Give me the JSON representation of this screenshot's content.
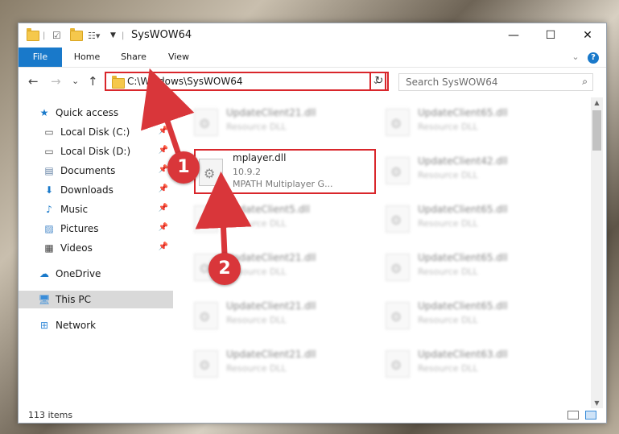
{
  "window": {
    "title": "SysWOW64",
    "minimize": "—",
    "maximize": "☐",
    "close": "✕"
  },
  "ribbon": {
    "tabs": [
      "File",
      "Home",
      "Share",
      "View"
    ],
    "collapse": "⌄",
    "help": "?"
  },
  "nav": {
    "back": "←",
    "forward": "→",
    "recent": "⌄",
    "up": "↑",
    "address": "C:\\Windows\\SysWOW64",
    "refresh": "↻",
    "search_placeholder": "Search SysWOW64"
  },
  "sidebar": {
    "items": [
      {
        "label": "Quick access",
        "icon": "star-icon",
        "pinned": false
      },
      {
        "label": "Local Disk (C:)",
        "icon": "drive-icon",
        "pinned": true
      },
      {
        "label": "Local Disk (D:)",
        "icon": "drive-icon",
        "pinned": true
      },
      {
        "label": "Documents",
        "icon": "documents-icon",
        "pinned": true
      },
      {
        "label": "Downloads",
        "icon": "downloads-icon",
        "pinned": true
      },
      {
        "label": "Music",
        "icon": "music-icon",
        "pinned": true
      },
      {
        "label": "Pictures",
        "icon": "pictures-icon",
        "pinned": true
      },
      {
        "label": "Videos",
        "icon": "videos-icon",
        "pinned": true
      },
      {
        "label": "OneDrive",
        "icon": "cloud-icon",
        "pinned": false
      },
      {
        "label": "This PC",
        "icon": "computer-icon",
        "pinned": false
      },
      {
        "label": "Network",
        "icon": "network-icon",
        "pinned": false
      }
    ]
  },
  "files": {
    "highlighted": {
      "name": "mplayer.dll",
      "version": "10.9.2",
      "description": "MPATH Multiplayer G..."
    },
    "left": [
      {
        "name": "UpdateClient21.dll",
        "type": "Resource DLL"
      },
      {
        "name": "UpdateClient5.dll",
        "type": "Resource DLL"
      },
      {
        "name": "UpdateClient21.dll",
        "type": "Resource DLL"
      },
      {
        "name": "UpdateClient21.dll",
        "type": "Resource DLL"
      },
      {
        "name": "UpdateClient21.dll",
        "type": "Resource DLL"
      }
    ],
    "right": [
      {
        "name": "UpdateClient65.dll",
        "type": "Resource DLL"
      },
      {
        "name": "UpdateClient42.dll",
        "type": "Resource DLL"
      },
      {
        "name": "UpdateClient65.dll",
        "type": "Resource DLL"
      },
      {
        "name": "UpdateClient65.dll",
        "type": "Resource DLL"
      },
      {
        "name": "UpdateClient65.dll",
        "type": "Resource DLL"
      },
      {
        "name": "UpdateClient63.dll",
        "type": "Resource DLL"
      }
    ]
  },
  "status": {
    "count": "113 items"
  },
  "callouts": [
    "1",
    "2"
  ],
  "colors": {
    "accent": "#1979ca",
    "highlight": "#d9262b",
    "badge": "#d9363a"
  }
}
